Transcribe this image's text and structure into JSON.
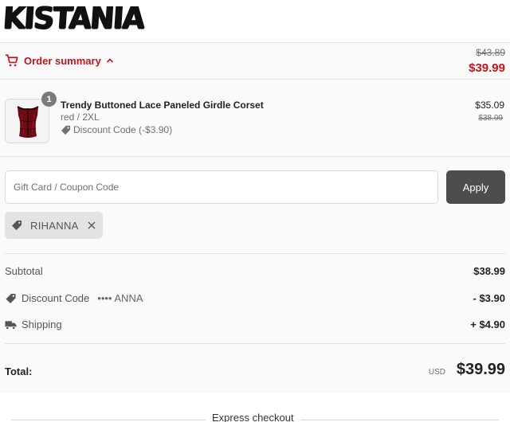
{
  "brand": {
    "logo_text": "KISTANIA"
  },
  "summary": {
    "toggle_label": "Order summary",
    "original_total": "$43.89",
    "total": "$39.99",
    "accent_color": "#c4151c"
  },
  "line_items": [
    {
      "title": "Trendy Buttoned Lace Paneled Girdle Corset",
      "variant": "red / 2XL",
      "discount": "Discount Code (-$3.90)",
      "price": "$35.09",
      "compare_at": "$38.99",
      "quantity": "1"
    }
  ],
  "coupon": {
    "placeholder": "Gift Card / Coupon Code",
    "apply_label": "Apply",
    "applied_code": "RIHANNA"
  },
  "totals": {
    "subtotal_label": "Subtotal",
    "subtotal": "$38.99",
    "discount_label": "Discount Code",
    "discount_mask": "•••• ANNA",
    "discount_value": "- $3.90",
    "shipping_label": "Shipping",
    "shipping_value": "+ $4.90",
    "total_label": "Total:",
    "currency": "USD",
    "total_value": "$39.99"
  },
  "express": {
    "label": "Express checkout"
  },
  "icons": [
    "cart-icon",
    "chevron-up-icon",
    "tag-icon",
    "close-icon",
    "truck-icon"
  ]
}
